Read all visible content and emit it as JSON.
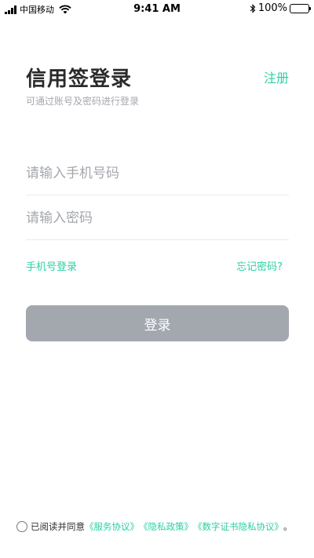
{
  "status_bar": {
    "carrier": "中国移动",
    "time": "9:41 AM",
    "battery": "100%"
  },
  "header": {
    "title": "信用签登录",
    "register_label": "注册",
    "subtitle": "可通过账号及密码进行登录"
  },
  "form": {
    "phone_placeholder": "请输入手机号码",
    "phone_value": "",
    "password_placeholder": "请输入密码",
    "password_value": ""
  },
  "links": {
    "phone_login": "手机号登录",
    "forgot_password": "忘记密码?"
  },
  "login_button": "登录",
  "agreement": {
    "prefix": "已阅读并同意",
    "docs": [
      "《服务协议》",
      "《隐私政策》",
      "《数字证书隐私协议》"
    ],
    "suffix": "。"
  },
  "colors": {
    "accent": "#2ccfa3",
    "button_disabled": "#a3a7ae",
    "placeholder": "#a4a7ad"
  }
}
